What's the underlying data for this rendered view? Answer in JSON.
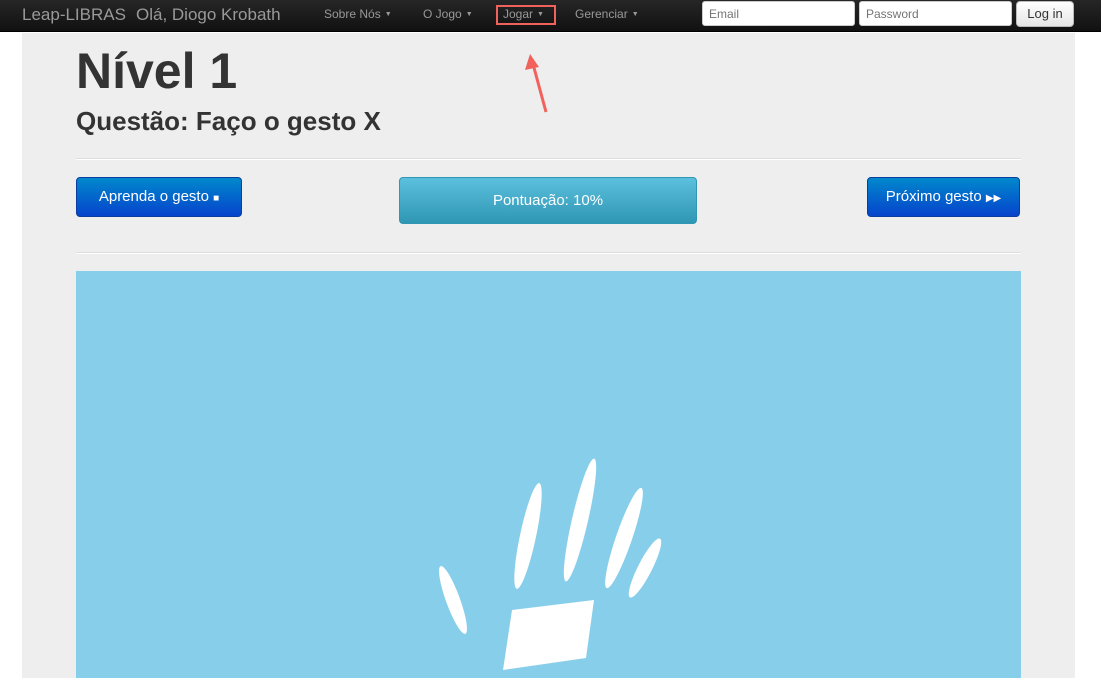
{
  "navbar": {
    "brand": "Leap-LIBRAS",
    "greeting": "Olá, Diogo Krobath",
    "menus": [
      "Sobre Nós",
      "O Jogo",
      "Jogar",
      "Gerenciar"
    ],
    "email_placeholder": "Email",
    "password_placeholder": "Password",
    "login_label": "Log in"
  },
  "main": {
    "level_title": "Nível 1",
    "question": "Questão: Faço o gesto X",
    "learn_button": "Aprenda o gesto",
    "score": "Pontuação: 10%",
    "next_button": "Próximo gesto"
  },
  "colors": {
    "annotation": "#f0625b",
    "stage": "#87ceeb"
  }
}
